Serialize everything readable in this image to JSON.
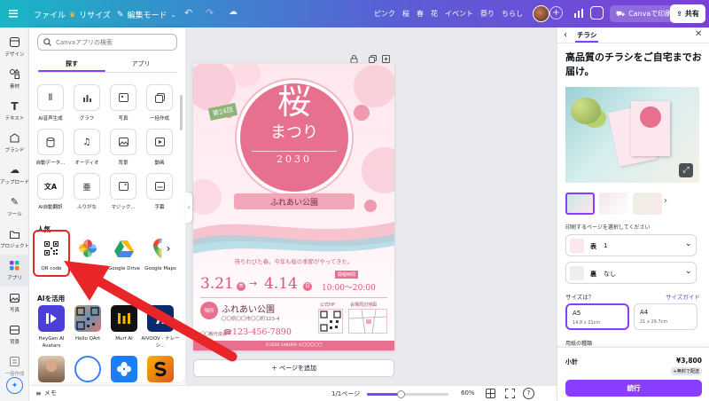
{
  "topbar": {
    "menu": [
      "ファイル",
      "リサイズ",
      "編集モード"
    ],
    "title": "ピンク　桜　春　花　イベント　祭り　ちらし",
    "print_label": "Canvaで印刷",
    "share_label": "共有"
  },
  "rail": [
    "デザイン",
    "素材",
    "テキスト",
    "ブランド",
    "アップロード",
    "ツール",
    "プロジェクト",
    "アプリ",
    "写真",
    "背景",
    "一括作成"
  ],
  "panel": {
    "search_placeholder": "Canvaアプリの検索",
    "tabs": [
      "探す",
      "アプリ"
    ],
    "grid": [
      "AI音声生成",
      "グラフ",
      "写真",
      "一括作成",
      "自動データ...",
      "オーディオ",
      "背景",
      "動画",
      "AI自動翻訳",
      "ふりがな",
      "マジック...",
      "字幕"
    ],
    "popular_heading": "人気",
    "popular": [
      "QR code",
      "フォト",
      "Google Drive",
      "Google Maps"
    ],
    "ai_heading": "AIを活用",
    "ai_apps": [
      "HeyGen AI Avatars",
      "Hello QArt",
      "Murf AI",
      "AIVOOV - ナレーシ..."
    ]
  },
  "flyer": {
    "badge": "第24回",
    "title_main": "桜",
    "title_sub": "まつり",
    "year": "2030",
    "park": "ふれあい公園",
    "tagline": "待ちわびた春。今年も桜の季節がやってきた。",
    "date_label": "開催時間",
    "date_start": "3.21",
    "day_start": "木",
    "arrow": "→",
    "date_end": "4.14",
    "day_end": "日",
    "time": "10:00～20:00",
    "venue_badge": "場所",
    "venue_name": "ふれあい公園",
    "address": "〇〇県〇〇市〇〇町123-4",
    "hp_label": "公式HP",
    "map_label": "会場周辺地図",
    "organizer": "〇〇観光協会",
    "phone": "123-456-7890",
    "footer": "©2030 SAKURA ©〇〇〇〇〇"
  },
  "add_page_label": "＋ ページを追加",
  "bottombar": {
    "notes_label": "メモ",
    "page_indicator": "1/1ページ",
    "zoom": "60%",
    "zoom_level": 0.42
  },
  "right": {
    "tab": "チラシ",
    "headline": "高品質のチラシをご自宅までお届け。",
    "select_pages_label": "印刷するページを選択してください",
    "front_label": "表",
    "front_value": "1",
    "back_label": "裏",
    "back_value": "なし",
    "size_label": "サイズは？",
    "size_guide": "サイズガイド",
    "sizes": [
      {
        "name": "A5",
        "dims": "14.8 x 21cm"
      },
      {
        "name": "A4",
        "dims": "21 x 29.7cm"
      }
    ],
    "paper_label": "用紙の種類",
    "subtotal_label": "小計",
    "price": "¥3,800",
    "shipping_badge": "+無料で配送",
    "continue_label": "続行"
  },
  "colors": {
    "accent": "#8b3dff",
    "pink": "#e6708e",
    "callout": "#e8262a"
  }
}
